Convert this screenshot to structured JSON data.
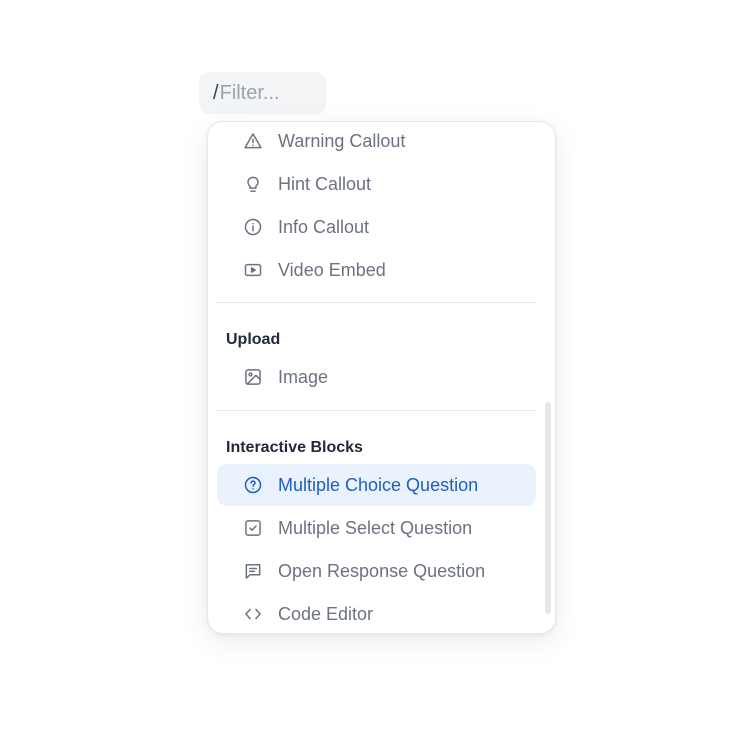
{
  "filter": {
    "slash": "/",
    "placeholder": "Filter..."
  },
  "menu": {
    "callouts": [
      {
        "label": "Warning Callout",
        "icon": "warning-icon"
      },
      {
        "label": "Hint Callout",
        "icon": "lightbulb-icon"
      },
      {
        "label": "Info Callout",
        "icon": "info-icon"
      },
      {
        "label": "Video Embed",
        "icon": "video-icon"
      }
    ],
    "upload": {
      "title": "Upload",
      "items": [
        {
          "label": "Image",
          "icon": "image-icon"
        }
      ]
    },
    "interactive": {
      "title": "Interactive Blocks",
      "items": [
        {
          "label": "Multiple Choice Question",
          "icon": "question-circle-icon",
          "active": true
        },
        {
          "label": "Multiple Select Question",
          "icon": "checkbox-icon"
        },
        {
          "label": "Open Response Question",
          "icon": "message-square-icon"
        },
        {
          "label": "Code Editor",
          "icon": "code-icon"
        }
      ]
    }
  },
  "colors": {
    "accent": "#1d5fc4",
    "active_bg": "#eaf3fd",
    "text_muted": "#6b7280",
    "heading": "#1f2937"
  }
}
